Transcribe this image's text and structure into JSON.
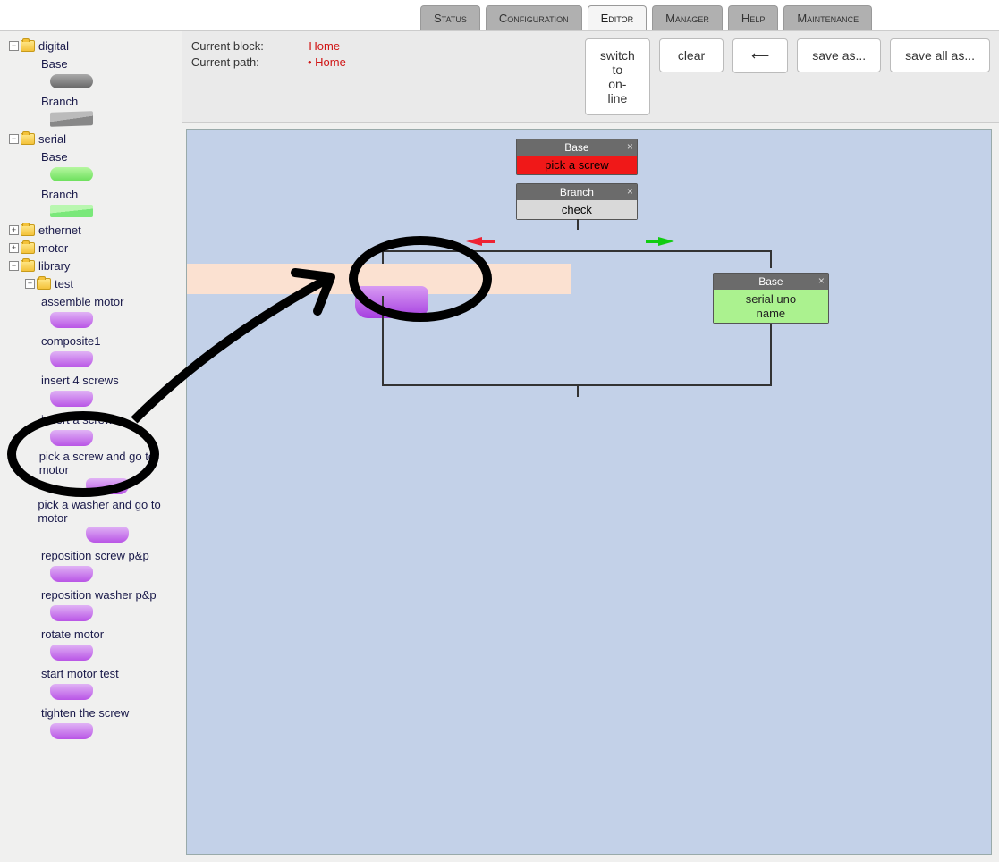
{
  "tabs": [
    {
      "label": "Status",
      "active": false
    },
    {
      "label": "Configuration",
      "active": false
    },
    {
      "label": "Editor",
      "active": true
    },
    {
      "label": "Manager",
      "active": false
    },
    {
      "label": "Help",
      "active": false
    },
    {
      "label": "Maintenance",
      "active": false
    }
  ],
  "toolbar": {
    "current_block_label": "Current block:",
    "current_block_value": "Home",
    "current_path_label": "Current path:",
    "current_path_bullet": "• ",
    "current_path_value": "Home",
    "switch_online": "switch to\non-line",
    "clear": "clear",
    "back_glyph": "⟵",
    "save_as": "save as...",
    "save_all_as": "save all as..."
  },
  "tree": {
    "digital": {
      "label": "digital",
      "base": "Base",
      "branch": "Branch"
    },
    "serial": {
      "label": "serial",
      "base": "Base",
      "branch": "Branch"
    },
    "ethernet": {
      "label": "ethernet"
    },
    "motor": {
      "label": "motor"
    },
    "library": {
      "label": "library",
      "test": "test",
      "items": [
        "assemble motor",
        "composite1",
        "insert 4 screws",
        "insert a screw",
        "pick a screw and go to motor",
        "pick a washer and go to motor",
        "reposition screw p&p",
        "reposition washer p&p",
        "rotate motor",
        "start motor test",
        "tighten the screw"
      ]
    }
  },
  "canvas": {
    "node_base": {
      "title": "Base",
      "body": "pick a screw"
    },
    "node_branch": {
      "title": "Branch",
      "body": "check"
    },
    "node_green": {
      "title": "Base",
      "line1": "serial uno",
      "line2": "name"
    },
    "close_glyph": "×"
  }
}
